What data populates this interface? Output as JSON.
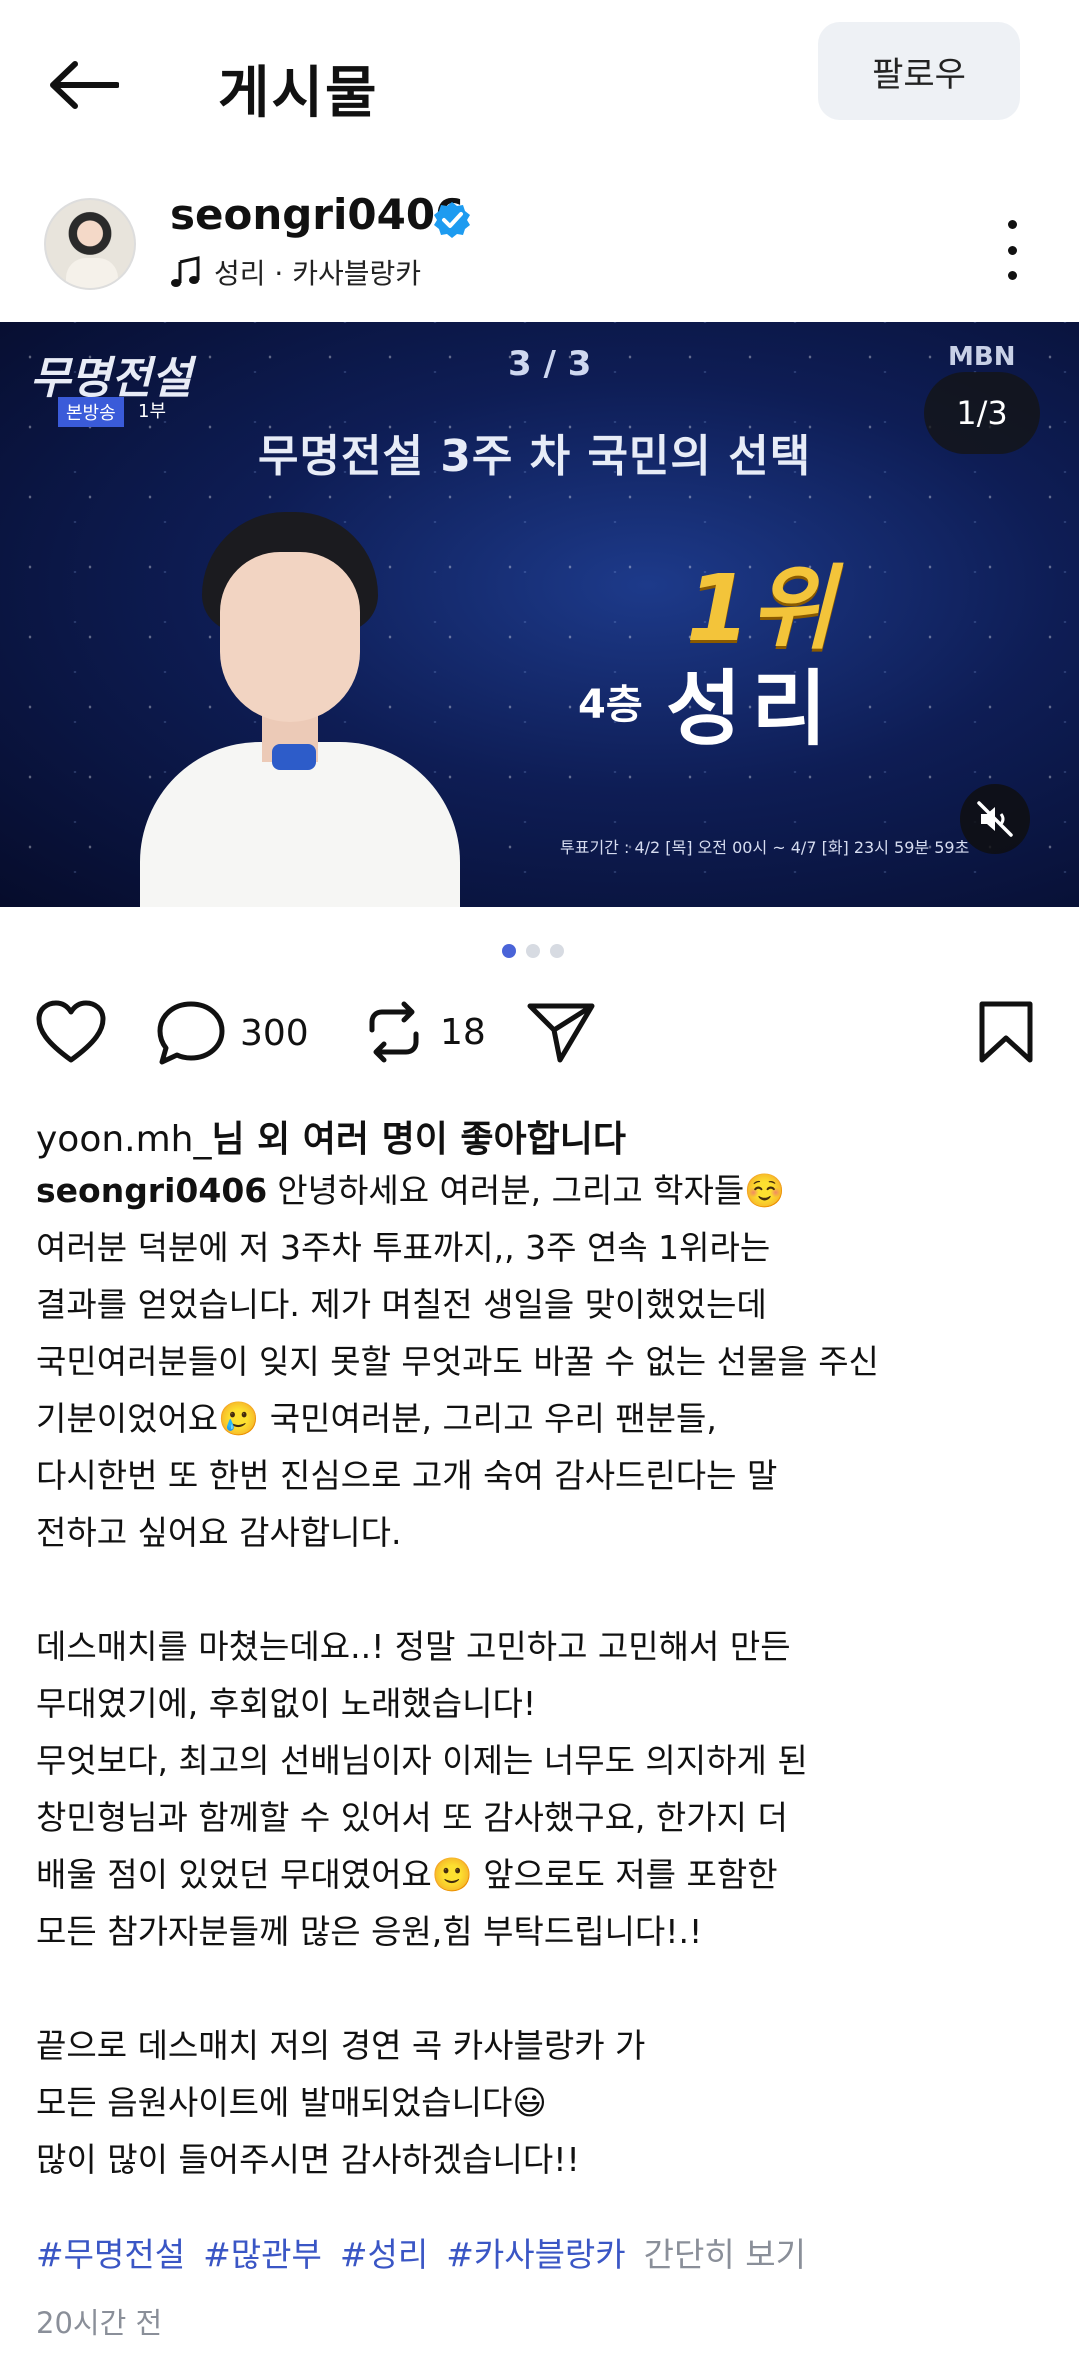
{
  "header": {
    "title": "게시물",
    "follow_label": "팔로우"
  },
  "author": {
    "username": "seongri0406",
    "music": "성리 · 카사블랑카"
  },
  "media": {
    "show_logo": "무명전설",
    "show_sub": "본방송",
    "show_part": "1부",
    "page_indicator": "3 / 3",
    "network": "MBN",
    "counter": "1/3",
    "headline": "무명전설 3주 차 국민의 선택",
    "rank": "1위",
    "floor": "4층",
    "name": "성리",
    "period": "투표기간 : 4/2 [목] 오전 00시 ~ 4/7 [화] 23시 59분 59초"
  },
  "carousel": {
    "total": 3,
    "active_index": 0
  },
  "actions": {
    "comments": "300",
    "reposts": "18"
  },
  "likes": {
    "user": "yoon.mh_",
    "text": "님 외 여러 명이 좋아합니다"
  },
  "caption": {
    "user": "seongri0406",
    "lines": [
      "안녕하세요 여러분, 그리고 학자들☺️",
      "여러분 덕분에 저 3주차 투표까지,, 3주 연속 1위라는",
      "결과를 얻었습니다. 제가 며칠전 생일을 맞이했었는데",
      "국민여러분들이 잊지 못할 무엇과도 바꿀 수 없는 선물을 주신",
      "기분이었어요🥲 국민여러분, 그리고 우리 팬분들,",
      "다시한번 또 한번 진심으로 고개 숙여 감사드린다는 말",
      "전하고 싶어요 감사합니다.",
      "",
      "데스매치를 마쳤는데요..! 정말 고민하고 고민해서 만든",
      "무대였기에, 후회없이 노래했습니다!",
      "무엇보다, 최고의 선배님이자 이제는 너무도 의지하게 된",
      "창민형님과 함께할 수 있어서 또 감사했구요, 한가지 더",
      "배울 점이 있었던 무대였어요🙂 앞으로도 저를 포함한",
      "모든 참가자분들께 많은 응원,힘 부탁드립니다!.!",
      "",
      "끝으로 데스매치 저의 경연 곡 카사블랑카 가",
      "모든 음원사이트에 발매되었습니다😃",
      "많이 많이 들어주시면 감사하겠습니다!!"
    ]
  },
  "tags": [
    "#무명전설",
    "#많관부",
    "#성리",
    "#카사블랑카"
  ],
  "more_label": "간단히 보기",
  "timestamp": "20시간 전",
  "colors": {
    "accent": "#4a64d8",
    "hashtag": "#3a56c5",
    "muted": "#8a8f99",
    "verified": "#1d9bf0",
    "follow_bg": "#eef1f5"
  }
}
